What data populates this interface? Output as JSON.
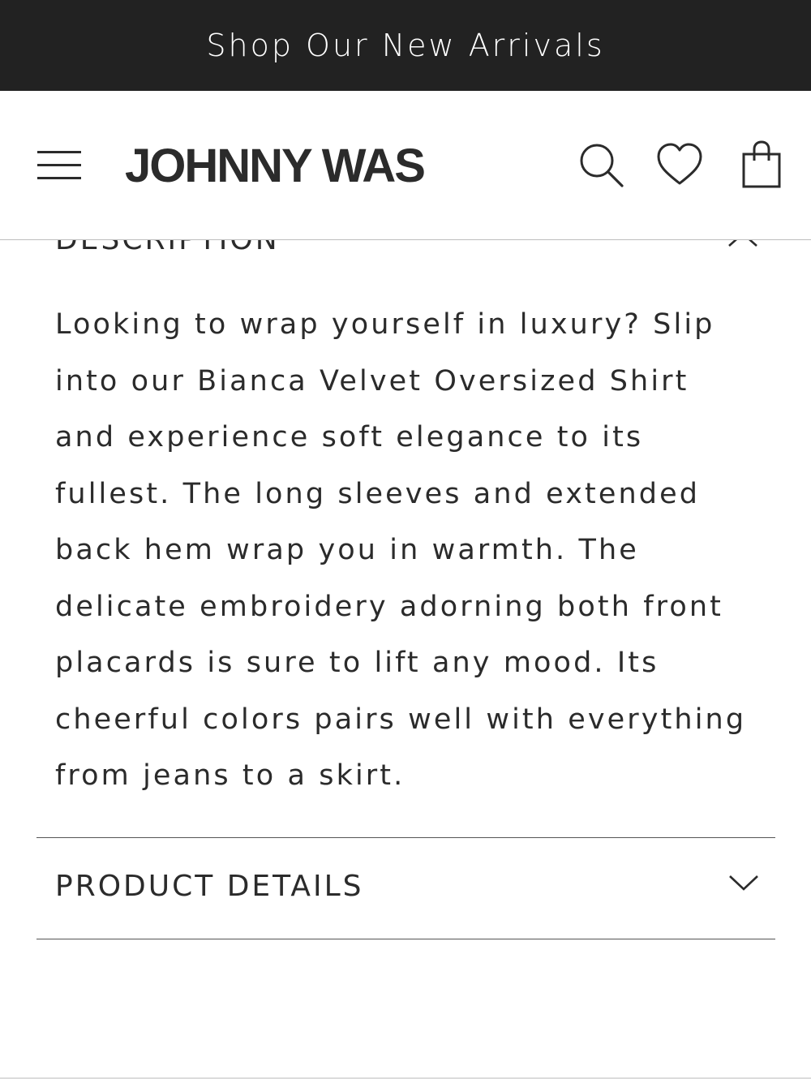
{
  "promo": {
    "text": "Shop Our New Arrivals"
  },
  "header": {
    "logo": "JOHNNY WAS",
    "icons": [
      "menu-icon",
      "search-icon",
      "heart-icon",
      "bag-icon"
    ]
  },
  "description": {
    "heading": "DESCRIPTION",
    "body": "Looking to wrap yourself in luxury? Slip\ninto our Bianca Velvet Oversized Shirt\nand experience soft elegance to its\nfullest. The long sleeves and extended\nback hem wrap you in warmth. The\ndelicate embroidery adorning both front\nplacards is sure to lift any mood. Its\ncheerful colors pairs well with everything\nfrom jeans to a skirt."
  },
  "details": {
    "heading": "PRODUCT DETAILS"
  },
  "colors": {
    "promo_bg": "#222222",
    "text": "#2b2b2b",
    "divider": "#555555"
  }
}
